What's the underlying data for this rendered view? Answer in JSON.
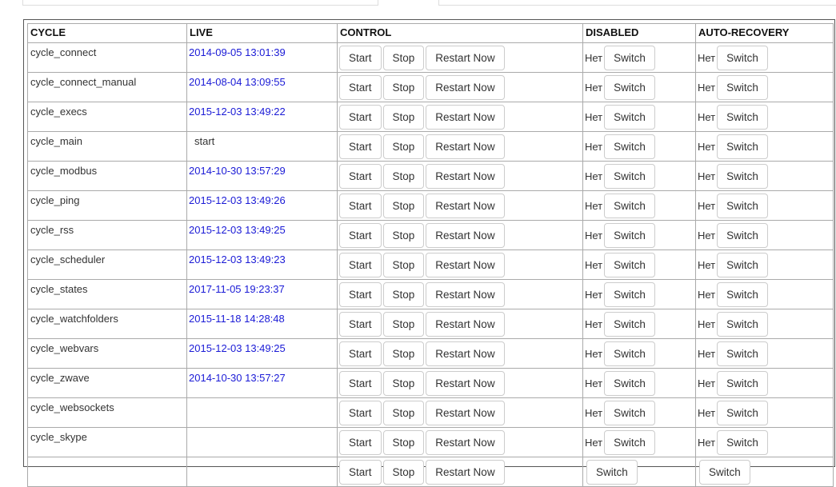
{
  "headers": {
    "cycle": "CYCLE",
    "live": "LIVE",
    "control": "CONTROL",
    "disabled": "DISABLED",
    "auto_recovery": "AUTO-RECOVERY"
  },
  "buttons": {
    "start": "Start",
    "stop": "Stop",
    "restart": "Restart Now",
    "switch": "Switch"
  },
  "rows": [
    {
      "name": "cycle_connect",
      "live": "2014-09-05 13:01:39",
      "live_is_link": true,
      "disabled": "Нет",
      "auto_recovery": "Нет"
    },
    {
      "name": "cycle_connect_manual",
      "live": "2014-08-04 13:09:55",
      "live_is_link": true,
      "disabled": "Нет",
      "auto_recovery": "Нет"
    },
    {
      "name": "cycle_execs",
      "live": "2015-12-03 13:49:22",
      "live_is_link": true,
      "disabled": "Нет",
      "auto_recovery": "Нет"
    },
    {
      "name": "cycle_main",
      "live": "start",
      "live_is_link": false,
      "disabled": "Нет",
      "auto_recovery": "Нет"
    },
    {
      "name": "cycle_modbus",
      "live": "2014-10-30 13:57:29",
      "live_is_link": true,
      "disabled": "Нет",
      "auto_recovery": "Нет"
    },
    {
      "name": "cycle_ping",
      "live": "2015-12-03 13:49:26",
      "live_is_link": true,
      "disabled": "Нет",
      "auto_recovery": "Нет"
    },
    {
      "name": "cycle_rss",
      "live": "2015-12-03 13:49:25",
      "live_is_link": true,
      "disabled": "Нет",
      "auto_recovery": "Нет"
    },
    {
      "name": "cycle_scheduler",
      "live": "2015-12-03 13:49:23",
      "live_is_link": true,
      "disabled": "Нет",
      "auto_recovery": "Нет"
    },
    {
      "name": "cycle_states",
      "live": "2017-11-05 19:23:37",
      "live_is_link": true,
      "disabled": "Нет",
      "auto_recovery": "Нет"
    },
    {
      "name": "cycle_watchfolders",
      "live": "2015-11-18 14:28:48",
      "live_is_link": true,
      "disabled": "Нет",
      "auto_recovery": "Нет"
    },
    {
      "name": "cycle_webvars",
      "live": "2015-12-03 13:49:25",
      "live_is_link": true,
      "disabled": "Нет",
      "auto_recovery": "Нет"
    },
    {
      "name": "cycle_zwave",
      "live": "2014-10-30 13:57:27",
      "live_is_link": true,
      "disabled": "Нет",
      "auto_recovery": "Нет"
    },
    {
      "name": "cycle_websockets",
      "live": "",
      "live_is_link": false,
      "disabled": "Нет",
      "auto_recovery": "Нет"
    },
    {
      "name": "cycle_skype",
      "live": "",
      "live_is_link": false,
      "disabled": "Нет",
      "auto_recovery": "Нет"
    },
    {
      "name": "",
      "live": "",
      "live_is_link": false,
      "disabled": "",
      "auto_recovery": ""
    }
  ],
  "colors": {
    "link": "#1a1ad6",
    "border": "#aaaaaa",
    "button_border": "#cccccc"
  }
}
